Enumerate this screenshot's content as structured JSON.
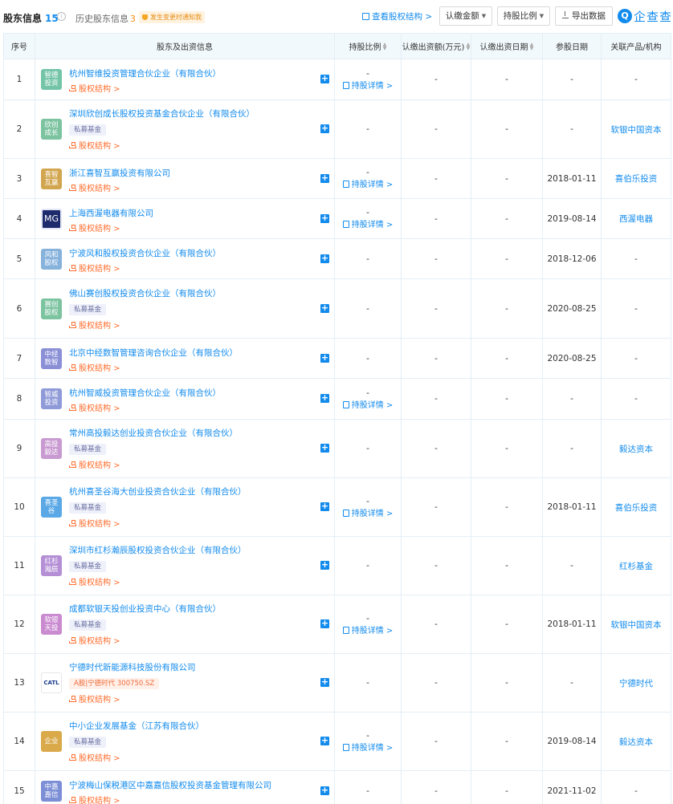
{
  "header": {
    "title": "股东信息",
    "count": "15",
    "info_icon": "i",
    "history_label": "历史股东信息",
    "history_count": "3",
    "notify_label": "发生变更时通知我",
    "view_structure": "查看股权结构 >",
    "btn_amount": "认缴金额",
    "btn_ratio": "持股比例",
    "btn_export": "导出数据",
    "logo_mark": "Q",
    "logo_text": "企查查"
  },
  "columns": {
    "idx": "序号",
    "shareholder": "股东及出资信息",
    "ratio": "持股比例",
    "subscribed_amount": "认缴出资额(万元)",
    "subscribed_date": "认缴出资日期",
    "join_date": "参股日期",
    "related": "关联产品/机构"
  },
  "common": {
    "structure_link": "股权结构 >",
    "detail_link": "持股详情 >",
    "dash": "-"
  },
  "rows": [
    {
      "idx": "1",
      "logo": "智德投资",
      "logo_color": "#74c4a8",
      "name": "杭州智维投资管理合伙企业（有限合伙）",
      "tag": "",
      "ratio": "-",
      "detail": true,
      "amount": "-",
      "sub_date": "-",
      "join_date": "-",
      "related": "-"
    },
    {
      "idx": "2",
      "logo": "欣创成长",
      "logo_color": "#7cc3a0",
      "name": "深圳欣创成长股权投资基金合伙企业（有限合伙）",
      "tag": "私募基金",
      "ratio": "-",
      "detail": false,
      "amount": "-",
      "sub_date": "-",
      "join_date": "-",
      "related": "软银中国资本"
    },
    {
      "idx": "3",
      "logo": "喜智互赢",
      "logo_color": "#d2a64f",
      "name": "浙江喜智互赢投资有限公司",
      "tag": "",
      "ratio": "-",
      "detail": true,
      "amount": "-",
      "sub_date": "-",
      "join_date": "2018-01-11",
      "related": "喜伯乐投资"
    },
    {
      "idx": "4",
      "logo": "MG",
      "logo_color": "#1d2a6b",
      "name": "上海西渥电器有限公司",
      "tag": "",
      "ratio": "-",
      "detail": true,
      "amount": "-",
      "sub_date": "-",
      "join_date": "2019-08-14",
      "related": "西渥电器"
    },
    {
      "idx": "5",
      "logo": "风和股权",
      "logo_color": "#86b2db",
      "name": "宁波风和股权投资合伙企业（有限合伙）",
      "tag": "",
      "ratio": "-",
      "detail": false,
      "amount": "-",
      "sub_date": "-",
      "join_date": "2018-12-06",
      "related": "-"
    },
    {
      "idx": "6",
      "logo": "赛创股权",
      "logo_color": "#7cc3a0",
      "name": "佛山赛创股权投资合伙企业（有限合伙）",
      "tag": "私募基金",
      "ratio": "-",
      "detail": false,
      "amount": "-",
      "sub_date": "-",
      "join_date": "2020-08-25",
      "related": "-"
    },
    {
      "idx": "7",
      "logo": "中经数智",
      "logo_color": "#8a8fd6",
      "name": "北京中经数智管理咨询合伙企业（有限合伙）",
      "tag": "",
      "ratio": "-",
      "detail": false,
      "amount": "-",
      "sub_date": "-",
      "join_date": "2020-08-25",
      "related": "-"
    },
    {
      "idx": "8",
      "logo": "智威投资",
      "logo_color": "#8f9ad8",
      "name": "杭州智威投资管理合伙企业（有限合伙）",
      "tag": "",
      "ratio": "-",
      "detail": true,
      "amount": "-",
      "sub_date": "-",
      "join_date": "-",
      "related": "-"
    },
    {
      "idx": "9",
      "logo": "高投毅达",
      "logo_color": "#c99ad1",
      "name": "常州高投毅达创业投资合伙企业（有限合伙）",
      "tag": "私募基金",
      "ratio": "-",
      "detail": false,
      "amount": "-",
      "sub_date": "-",
      "join_date": "-",
      "related": "毅达资本"
    },
    {
      "idx": "10",
      "logo": "喜圣谷",
      "logo_color": "#5aa8e6",
      "name": "杭州喜圣谷海大创业投资合伙企业（有限合伙）",
      "tag": "私募基金",
      "ratio": "-",
      "detail": true,
      "amount": "-",
      "sub_date": "-",
      "join_date": "2018-01-11",
      "related": "喜伯乐投资"
    },
    {
      "idx": "11",
      "logo": "红杉瀚辰",
      "logo_color": "#b48fd6",
      "name": "深圳市红杉瀚辰股权投资合伙企业（有限合伙）",
      "tag": "私募基金",
      "ratio": "-",
      "detail": false,
      "amount": "-",
      "sub_date": "-",
      "join_date": "-",
      "related": "红杉基金"
    },
    {
      "idx": "12",
      "logo": "软银天投",
      "logo_color": "#c98ad0",
      "name": "成都软银天投创业投资中心（有限合伙）",
      "tag": "私募基金",
      "ratio": "-",
      "detail": true,
      "amount": "-",
      "sub_date": "-",
      "join_date": "2018-01-11",
      "related": "软银中国资本"
    },
    {
      "idx": "13",
      "logo": "CATL",
      "logo_color": "#ffffff",
      "name": "宁德时代新能源科技股份有限公司",
      "tag": "A股|宁德时代 300750.SZ",
      "tag_type": "stock",
      "ratio": "-",
      "detail": false,
      "amount": "-",
      "sub_date": "-",
      "join_date": "-",
      "related": "宁德时代"
    },
    {
      "idx": "14",
      "logo": "企业",
      "logo_color": "#d9a94a",
      "name": "中小企业发展基金（江苏有限合伙）",
      "tag": "私募基金",
      "ratio": "-",
      "detail": true,
      "amount": "-",
      "sub_date": "-",
      "join_date": "2019-08-14",
      "related": "毅达资本"
    },
    {
      "idx": "15",
      "logo": "中嘉嘉信",
      "logo_color": "#7c8fd6",
      "name": "宁波梅山保税港区中嘉嘉信股权投资基金管理有限公司",
      "tag": "",
      "ratio": "-",
      "detail": false,
      "amount": "-",
      "sub_date": "-",
      "join_date": "2021-11-02",
      "related": "-"
    }
  ]
}
